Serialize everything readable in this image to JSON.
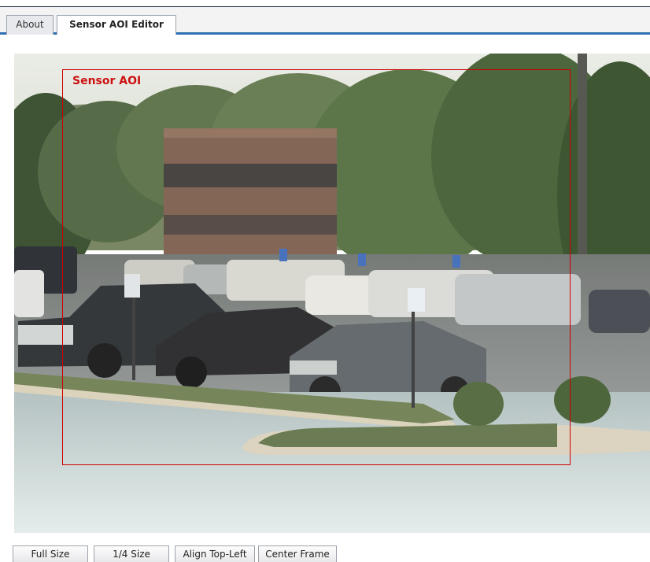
{
  "tabs": [
    {
      "label": "About",
      "active": false
    },
    {
      "label": "Sensor AOI Editor",
      "active": true
    }
  ],
  "aoi": {
    "label": "Sensor AOI",
    "color": "#cc0000"
  },
  "buttons": {
    "full_size": "Full Size",
    "quarter_size": "1/4 Size",
    "align_top_left": "Align Top-Left",
    "center_frame": "Center Frame"
  },
  "colors": {
    "tab_accent": "#2f6fb3",
    "aoi_border": "#cc0000"
  }
}
